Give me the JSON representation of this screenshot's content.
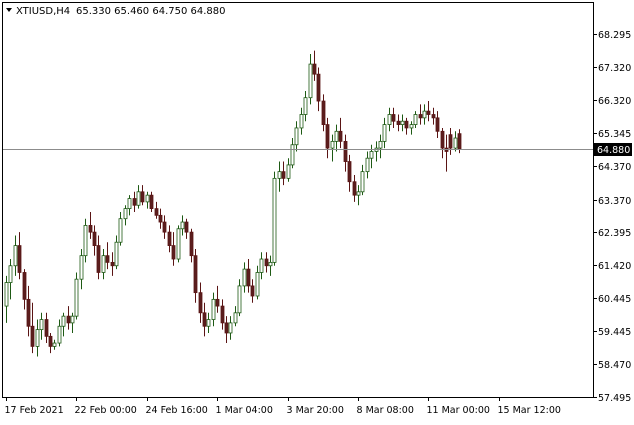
{
  "header": {
    "symbol": "XTIUSD",
    "timeframe": "H4",
    "title": "XTIUSD,H4",
    "open": "65.330",
    "high": "65.460",
    "low": "64.750",
    "close": "64.880",
    "ohlc_text": "65.330 65.460 64.750 64.880"
  },
  "colors": {
    "bull": "#1e5a14",
    "bull_fill": "#ffffff",
    "bear": "#5a1414",
    "bear_fill": "#5a1e1e",
    "price_line": "#8c8c8c",
    "price_label_bg": "#000000",
    "price_label_text": "#ffffff"
  },
  "chart_data": {
    "type": "candlestick",
    "current_price": 64.88,
    "current_price_label": "64.880",
    "ylim": [
      57.0,
      69.0
    ],
    "y_ticks": [
      "68.295",
      "67.320",
      "66.320",
      "65.345",
      "64.370",
      "63.370",
      "62.395",
      "61.420",
      "60.445",
      "59.445",
      "58.470",
      "57.495"
    ],
    "y_tick_values": [
      68.295,
      67.32,
      66.32,
      65.345,
      64.37,
      63.37,
      62.395,
      61.42,
      60.445,
      59.445,
      58.47,
      57.495
    ],
    "x_ticks": [
      {
        "label": "17 Feb 2021",
        "index": 0
      },
      {
        "label": "22 Feb 00:00",
        "index": 16
      },
      {
        "label": "24 Feb 16:00",
        "index": 32
      },
      {
        "label": "1 Mar 04:00",
        "index": 48
      },
      {
        "label": "3 Mar 20:00",
        "index": 64
      },
      {
        "label": "8 Mar 08:00",
        "index": 80
      },
      {
        "label": "11 Mar 00:00",
        "index": 96
      },
      {
        "label": "15 Mar 12:00",
        "index": 112
      }
    ],
    "candles": [
      [
        60.2,
        61.1,
        59.7,
        60.9
      ],
      [
        60.9,
        61.6,
        60.4,
        61.4
      ],
      [
        61.4,
        62.3,
        61.1,
        62.0
      ],
      [
        62.0,
        62.4,
        61.0,
        61.2
      ],
      [
        61.2,
        61.3,
        60.1,
        60.4
      ],
      [
        60.4,
        60.8,
        59.3,
        59.6
      ],
      [
        59.6,
        60.3,
        58.8,
        59.0
      ],
      [
        59.0,
        59.8,
        58.7,
        59.5
      ],
      [
        59.5,
        60.0,
        59.2,
        59.8
      ],
      [
        59.8,
        60.0,
        59.1,
        59.3
      ],
      [
        59.3,
        59.4,
        58.8,
        59.0
      ],
      [
        59.0,
        59.2,
        58.9,
        59.1
      ],
      [
        59.1,
        59.8,
        59.0,
        59.6
      ],
      [
        59.6,
        60.0,
        59.3,
        59.9
      ],
      [
        59.9,
        60.2,
        59.5,
        59.7
      ],
      [
        59.7,
        60.0,
        59.4,
        59.9
      ],
      [
        59.9,
        61.2,
        59.8,
        61.0
      ],
      [
        61.0,
        61.9,
        60.7,
        61.7
      ],
      [
        61.7,
        62.8,
        61.5,
        62.6
      ],
      [
        62.6,
        63.0,
        62.2,
        62.4
      ],
      [
        62.4,
        62.6,
        61.7,
        62.0
      ],
      [
        62.0,
        62.3,
        61.0,
        61.2
      ],
      [
        61.2,
        61.9,
        61.0,
        61.7
      ],
      [
        61.7,
        62.1,
        61.3,
        61.5
      ],
      [
        61.5,
        61.8,
        61.1,
        61.4
      ],
      [
        61.4,
        62.3,
        61.3,
        62.1
      ],
      [
        62.1,
        63.0,
        62.0,
        62.8
      ],
      [
        62.8,
        63.2,
        62.6,
        63.1
      ],
      [
        63.1,
        63.5,
        62.9,
        63.4
      ],
      [
        63.4,
        63.6,
        63.0,
        63.2
      ],
      [
        63.2,
        63.8,
        63.1,
        63.6
      ],
      [
        63.6,
        63.8,
        63.2,
        63.3
      ],
      [
        63.3,
        63.6,
        63.1,
        63.5
      ],
      [
        63.5,
        63.6,
        63.0,
        63.1
      ],
      [
        63.1,
        63.3,
        62.8,
        62.9
      ],
      [
        62.9,
        63.1,
        62.5,
        62.7
      ],
      [
        62.7,
        62.9,
        62.2,
        62.4
      ],
      [
        62.4,
        62.6,
        61.8,
        62.0
      ],
      [
        62.0,
        62.4,
        61.4,
        61.6
      ],
      [
        61.6,
        62.6,
        61.5,
        62.5
      ],
      [
        62.5,
        62.9,
        62.3,
        62.7
      ],
      [
        62.7,
        62.8,
        62.2,
        62.4
      ],
      [
        62.4,
        62.5,
        61.5,
        61.7
      ],
      [
        61.7,
        61.9,
        60.3,
        60.6
      ],
      [
        60.6,
        60.9,
        59.7,
        60.0
      ],
      [
        60.0,
        60.3,
        59.3,
        59.6
      ],
      [
        59.6,
        60.0,
        59.4,
        59.8
      ],
      [
        59.8,
        60.6,
        59.6,
        60.4
      ],
      [
        60.4,
        60.8,
        60.0,
        60.2
      ],
      [
        60.2,
        60.4,
        59.5,
        59.7
      ],
      [
        59.7,
        59.9,
        59.1,
        59.4
      ],
      [
        59.4,
        59.9,
        59.2,
        59.7
      ],
      [
        59.7,
        60.2,
        59.6,
        60.0
      ],
      [
        60.0,
        61.0,
        59.9,
        60.8
      ],
      [
        60.8,
        61.5,
        60.6,
        61.3
      ],
      [
        61.3,
        61.6,
        60.6,
        60.8
      ],
      [
        60.8,
        61.0,
        60.3,
        60.5
      ],
      [
        60.5,
        61.4,
        60.4,
        61.2
      ],
      [
        61.2,
        61.8,
        61.0,
        61.6
      ],
      [
        61.6,
        61.8,
        61.2,
        61.4
      ],
      [
        61.4,
        61.7,
        61.1,
        61.5
      ],
      [
        61.5,
        64.2,
        61.4,
        64.0
      ],
      [
        64.0,
        64.5,
        63.6,
        64.2
      ],
      [
        64.2,
        64.5,
        63.8,
        64.0
      ],
      [
        64.0,
        64.6,
        63.9,
        64.4
      ],
      [
        64.4,
        65.2,
        64.3,
        65.0
      ],
      [
        65.0,
        65.7,
        64.8,
        65.5
      ],
      [
        65.5,
        66.1,
        65.3,
        65.9
      ],
      [
        65.9,
        66.6,
        65.7,
        66.4
      ],
      [
        66.4,
        67.7,
        66.2,
        67.4
      ],
      [
        67.4,
        67.8,
        66.9,
        67.1
      ],
      [
        67.1,
        67.3,
        66.0,
        66.3
      ],
      [
        66.3,
        66.5,
        65.4,
        65.6
      ],
      [
        65.6,
        65.8,
        64.6,
        64.9
      ],
      [
        64.9,
        65.3,
        64.5,
        65.1
      ],
      [
        65.1,
        65.6,
        64.8,
        65.4
      ],
      [
        65.4,
        65.8,
        64.9,
        65.1
      ],
      [
        65.1,
        65.3,
        64.2,
        64.5
      ],
      [
        64.5,
        64.7,
        63.6,
        63.9
      ],
      [
        63.9,
        64.1,
        63.3,
        63.5
      ],
      [
        63.5,
        63.8,
        63.2,
        63.6
      ],
      [
        63.6,
        64.4,
        63.5,
        64.2
      ],
      [
        64.2,
        64.8,
        64.0,
        64.6
      ],
      [
        64.6,
        65.0,
        64.3,
        64.8
      ],
      [
        64.8,
        65.1,
        64.5,
        64.9
      ],
      [
        64.9,
        65.3,
        64.6,
        65.1
      ],
      [
        65.1,
        65.8,
        64.9,
        65.6
      ],
      [
        65.6,
        66.1,
        65.4,
        65.9
      ],
      [
        65.9,
        66.1,
        65.5,
        65.7
      ],
      [
        65.7,
        65.9,
        65.4,
        65.6
      ],
      [
        65.6,
        65.9,
        65.4,
        65.7
      ],
      [
        65.7,
        65.8,
        65.3,
        65.5
      ],
      [
        65.5,
        65.7,
        65.3,
        65.6
      ],
      [
        65.6,
        66.0,
        65.5,
        65.9
      ],
      [
        65.9,
        66.2,
        65.6,
        65.8
      ],
      [
        65.8,
        66.2,
        65.6,
        66.0
      ],
      [
        66.0,
        66.3,
        65.7,
        65.9
      ],
      [
        65.9,
        66.1,
        65.6,
        65.8
      ],
      [
        65.8,
        66.0,
        65.2,
        65.4
      ],
      [
        65.4,
        65.5,
        64.6,
        64.9
      ],
      [
        64.9,
        65.3,
        64.2,
        64.8
      ],
      [
        65.3,
        65.5,
        64.7,
        64.9
      ],
      [
        64.9,
        65.4,
        64.8,
        65.2
      ],
      [
        65.33,
        65.46,
        64.75,
        64.88
      ]
    ]
  }
}
